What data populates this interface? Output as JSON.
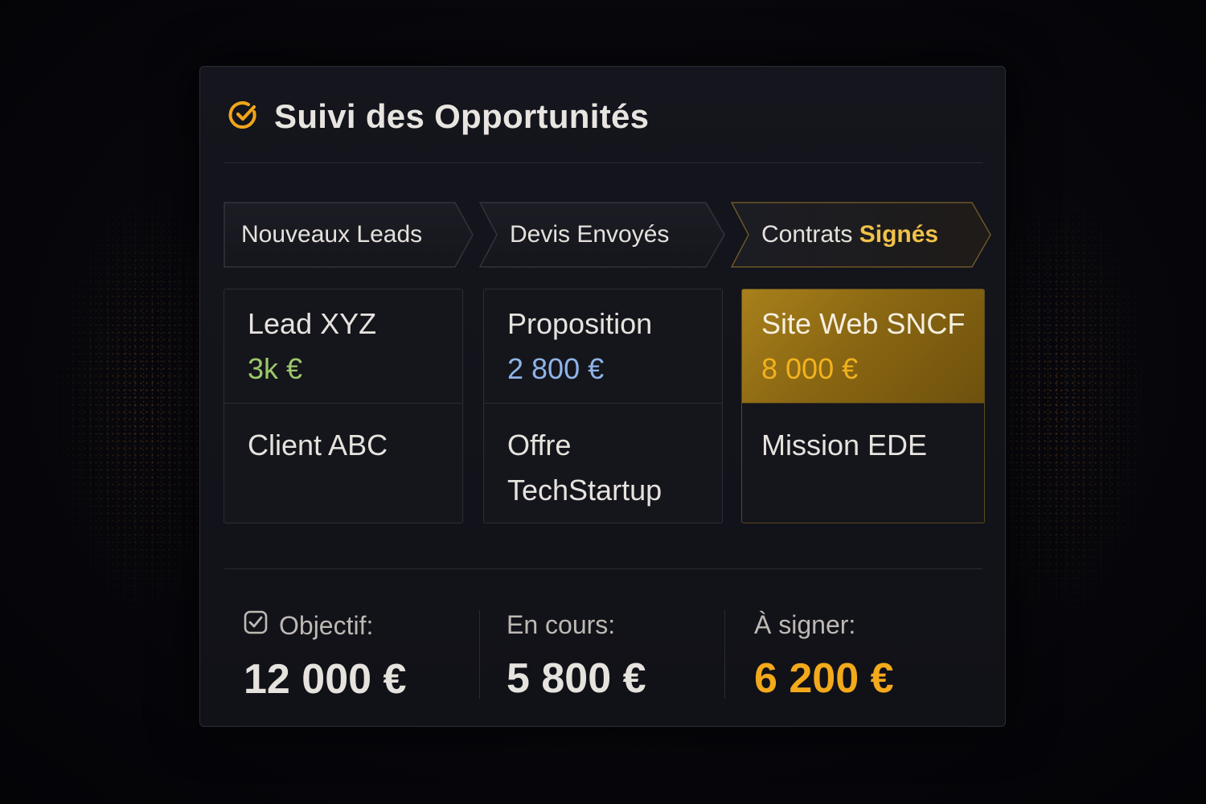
{
  "header": {
    "title": "Suivi des Opportunités",
    "icon": "check-circle-icon"
  },
  "stages": [
    {
      "label_main": "Nouveaux Leads",
      "label_highlight": ""
    },
    {
      "label_main": "Devis Envoyés",
      "label_highlight": ""
    },
    {
      "label_main": "Contrats ",
      "label_highlight": "Signés"
    }
  ],
  "cards": [
    {
      "name": "Lead XYZ",
      "amount": "3k €",
      "amount_color": "#9bc86a",
      "client": "Client ABC"
    },
    {
      "name": "Proposition",
      "amount": "2 800 €",
      "amount_color": "#8fb4e8",
      "client": "Offre TechStartup"
    },
    {
      "name": "Site Web SNCF",
      "amount": "8 000 €",
      "amount_color": "#f2b21e",
      "client": "Mission EDE"
    }
  ],
  "stats": {
    "objective": {
      "label": "Objectif:",
      "value": "12 000 €",
      "icon": "checkbox-icon"
    },
    "in_progress": {
      "label": "En cours:",
      "value": "5 800 €"
    },
    "to_sign": {
      "label": "À signer:",
      "value": "6 200 €",
      "value_color": "#f2a91b"
    }
  },
  "colors": {
    "accent": "#f2a91b",
    "background": "#0a0a10",
    "panel": "#13131a"
  }
}
